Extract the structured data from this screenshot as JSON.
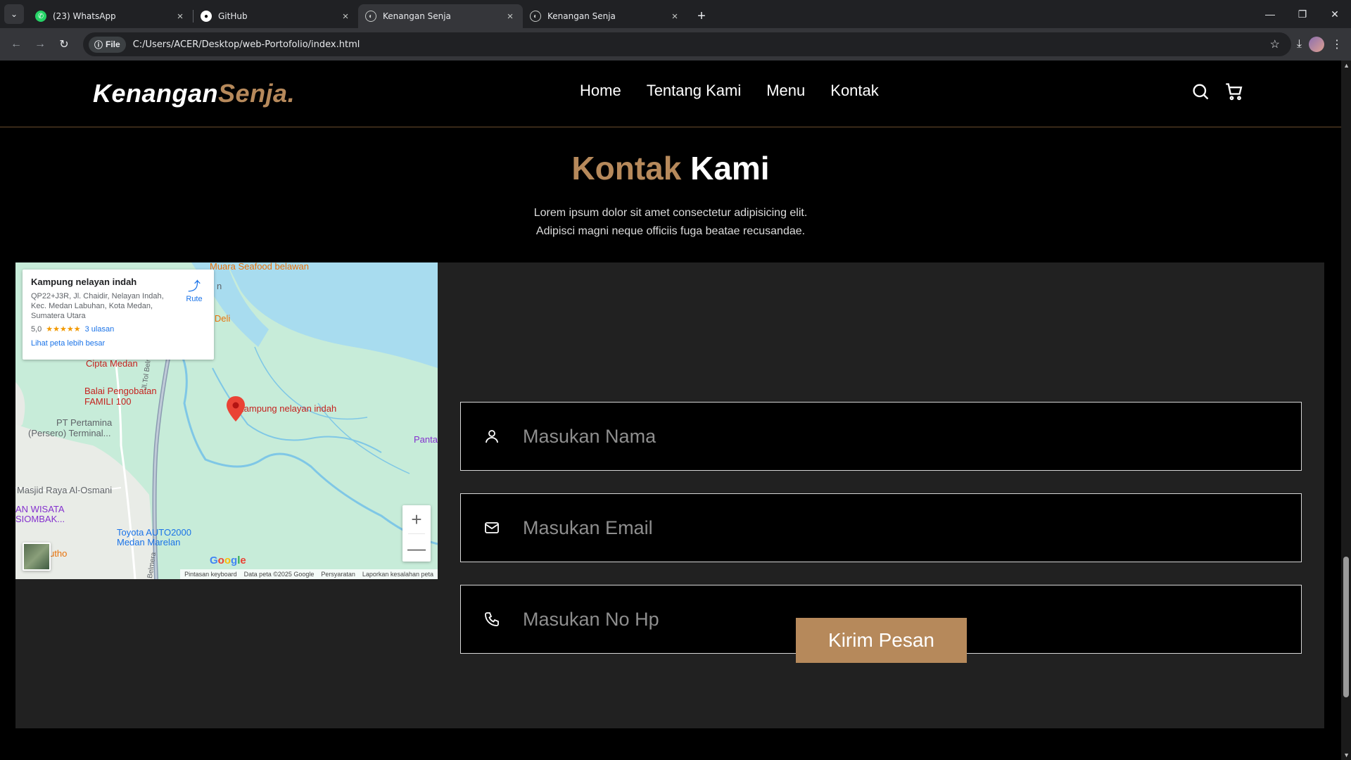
{
  "browser": {
    "tabs": [
      {
        "title": "(23) WhatsApp",
        "icon": "whatsapp-icon",
        "active": false
      },
      {
        "title": "GitHub",
        "icon": "github-icon",
        "active": false
      },
      {
        "title": "Kenangan Senja",
        "icon": "globe-icon",
        "active": true
      },
      {
        "title": "Kenangan Senja",
        "icon": "globe-icon",
        "active": false
      }
    ],
    "file_chip": "File",
    "url": "C:/Users/ACER/Desktop/web-Portofolio/index.html"
  },
  "page": {
    "brand": {
      "main": "Kenangan",
      "accent": "Senja."
    },
    "nav": [
      "Home",
      "Tentang Kami",
      "Menu",
      "Kontak"
    ],
    "section": {
      "title_accent": "Kontak",
      "title_main": "Kami",
      "desc_line1": "Lorem ipsum dolor sit amet consectetur adipisicing elit.",
      "desc_line2": "Adipisci magni neque officiis fuga beatae recusandae."
    },
    "map": {
      "card": {
        "name": "Kampung nelayan indah",
        "address": "QP22+J3R, Jl. Chaidir, Nelayan Indah, Kec. Medan Labuhan, Kota Medan, Sumatera Utara",
        "rating": "5,0",
        "stars": "★★★★★",
        "reviews": "3 ulasan",
        "bigger_map": "Lihat peta lebih besar",
        "route": "Rute"
      },
      "labels": {
        "seafood": "Muara Seafood belawan",
        "n": "n",
        "deli": "n Deli",
        "cipta": "Cipta Medan",
        "balai": "Balai Pengobatan",
        "famili": "FAMILI 100",
        "pertamina1": "PT Pertamina",
        "pertamina2": "(Persero) Terminal...",
        "kampung": "Kampung nelayan indah",
        "panta": "Panta",
        "masjid": "Masjid Raya Al-Osmani",
        "wisata1": "AN WISATA",
        "wisata2": "SIOMBAK...",
        "toyota1": "Toyota AUTO2000",
        "toyota2": "Medan Marelan",
        "utho": "utho",
        "road": "Jl.Tol Belmera",
        "road2": "Belmera"
      },
      "google": [
        "G",
        "o",
        "o",
        "g",
        "l",
        "e"
      ],
      "attribution": [
        "Pintasan keyboard",
        "Data peta ©2025 Google",
        "Persyaratan",
        "Laporkan kesalahan peta"
      ],
      "zoom_in": "+",
      "zoom_out": "—"
    },
    "form": {
      "name_placeholder": "Masukan Nama",
      "email_placeholder": "Masukan Email",
      "phone_placeholder": "Masukan No Hp",
      "submit": "Kirim Pesan"
    }
  },
  "colors": {
    "accent": "#b6895b",
    "panel": "#212121",
    "background": "#000000"
  }
}
